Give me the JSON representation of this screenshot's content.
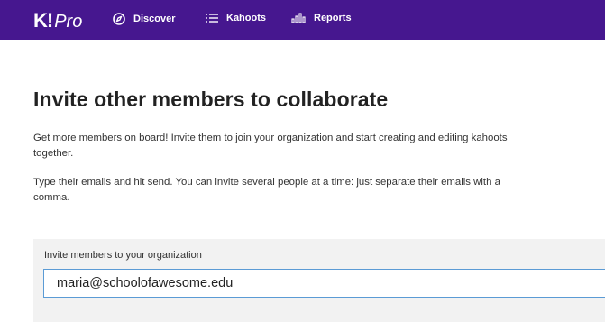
{
  "header": {
    "logo_k": "K!",
    "logo_pro": "Pro",
    "nav": [
      {
        "label": "Discover",
        "icon": "compass-icon"
      },
      {
        "label": "Kahoots",
        "icon": "list-icon"
      },
      {
        "label": "Reports",
        "icon": "bar-chart-icon"
      }
    ],
    "background_color": "#46178f"
  },
  "main": {
    "title": "Invite other members to collaborate",
    "paragraph1": "Get more members on board! Invite them to join your organization and start creating and editing kahoots together.",
    "paragraph2": "Type their emails and hit send. You can invite several people at a time: just separate their emails with a comma."
  },
  "invite": {
    "label": "Invite members to your organization",
    "value": "maria@schoolofawesome.edu",
    "input_border_color": "#5b9bd5"
  }
}
